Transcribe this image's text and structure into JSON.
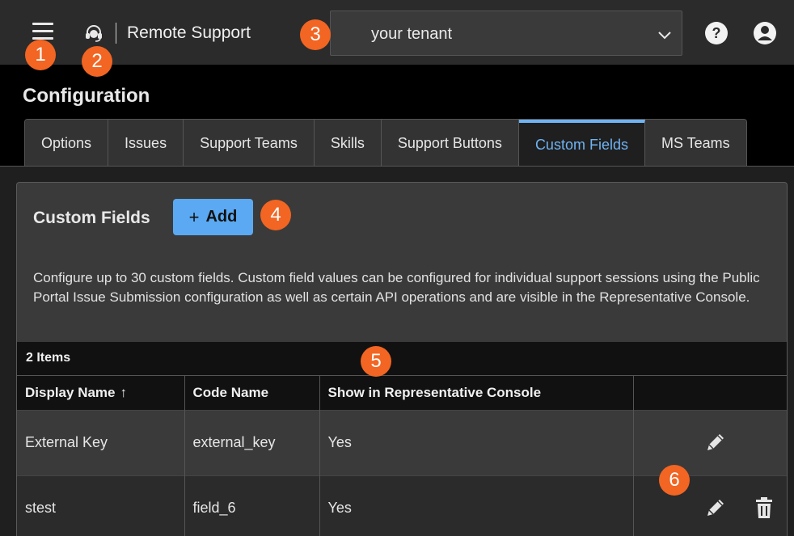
{
  "header": {
    "brand": "Remote Support",
    "tenant": "your tenant",
    "icons": [
      "menu-icon",
      "headset-icon",
      "chevron-down-icon",
      "help-icon",
      "user-icon"
    ]
  },
  "page": {
    "title": "Configuration"
  },
  "tabs": [
    {
      "label": "Options",
      "active": false
    },
    {
      "label": "Issues",
      "active": false
    },
    {
      "label": "Support Teams",
      "active": false
    },
    {
      "label": "Skills",
      "active": false
    },
    {
      "label": "Support Buttons",
      "active": false
    },
    {
      "label": "Custom Fields",
      "active": true
    },
    {
      "label": "MS Teams",
      "active": false
    }
  ],
  "panel": {
    "title": "Custom Fields",
    "add_label": "Add",
    "description": "Configure up to 30 custom fields. Custom field values can be configured for individual support sessions using the Public Portal Issue Submission configuration as well as certain API operations and are visible in the Representative Console."
  },
  "grid": {
    "count": "2 Items",
    "columns": [
      "Display Name",
      "Code Name",
      "Show in Representative Console",
      ""
    ],
    "sort_indicator": "↑",
    "rows": [
      {
        "display_name": "External Key",
        "code_name": "external_key",
        "show": "Yes"
      },
      {
        "display_name": "stest",
        "code_name": "field_6",
        "show": "Yes"
      }
    ]
  },
  "badges": [
    "1",
    "2",
    "3",
    "4",
    "5",
    "6"
  ],
  "colors": {
    "accent": "#6fb3f2",
    "add_button": "#5aa9f2",
    "badge": "#f26522"
  }
}
